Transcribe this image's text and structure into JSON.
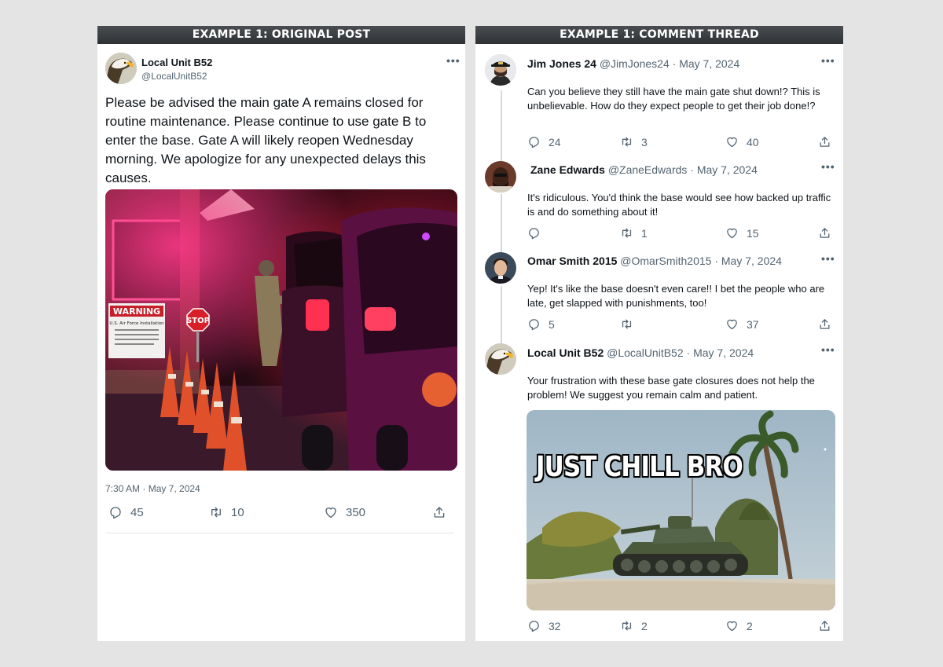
{
  "left_panel": {
    "header": "EXAMPLE 1: ORIGINAL POST",
    "post": {
      "author_name": "Local Unit B52",
      "author_handle": "@LocalUnitB52",
      "avatar_icon": "eagle-avatar",
      "text": "Please be advised the main gate A remains closed for routine maintenance. Please continue to use gate B to enter the base. Gate A will likely reopen Wednesday morning. We apologize for any unexpected delays this causes.",
      "image_signs": {
        "warning": "WARNING",
        "facility": "U.S. Air Force Installation",
        "stop": "STOP"
      },
      "timestamp": "7:30 AM · May 7, 2024",
      "replies": "45",
      "reposts": "10",
      "likes": "350"
    }
  },
  "right_panel": {
    "header": "EXAMPLE 1: COMMENT THREAD",
    "comments": [
      {
        "name": "Jim Jones 24",
        "handle": "@JimJones24",
        "date": "May 7, 2024",
        "text": "Can you believe they still have the main gate shut down!? This is unbelievable. How do they expect people to get their job done!?",
        "replies": "24",
        "reposts": "3",
        "likes": "40"
      },
      {
        "name": "Zane Edwards",
        "handle": "@ZaneEdwards",
        "date": "May 7, 2024",
        "text": "It's ridiculous. You'd think the base would see how backed up traffic is and do something about it!",
        "replies": "",
        "reposts": "1",
        "likes": "15"
      },
      {
        "name": "Omar Smith 2015",
        "handle": "@OmarSmith2015",
        "date": "May 7, 2024",
        "text": "Yep! It's like the base doesn't even care!! I bet the people who are late, get slapped with punishments, too!",
        "replies": "5",
        "reposts": "",
        "likes": "37"
      },
      {
        "name": "Local Unit B52",
        "handle": "@LocalUnitB52",
        "date": "May 7, 2024",
        "text": "Your frustration with these base gate closures does not help the problem! We suggest you remain calm and patient.",
        "meme_text": "JUST CHILL BRO",
        "replies": "32",
        "reposts": "2",
        "likes": "2"
      }
    ]
  },
  "dot_separator": "·",
  "more_label": "•••",
  "colors": {
    "header_bg": "#3a3d40",
    "text_secondary": "#536471",
    "thread_line": "#cfd9de"
  }
}
